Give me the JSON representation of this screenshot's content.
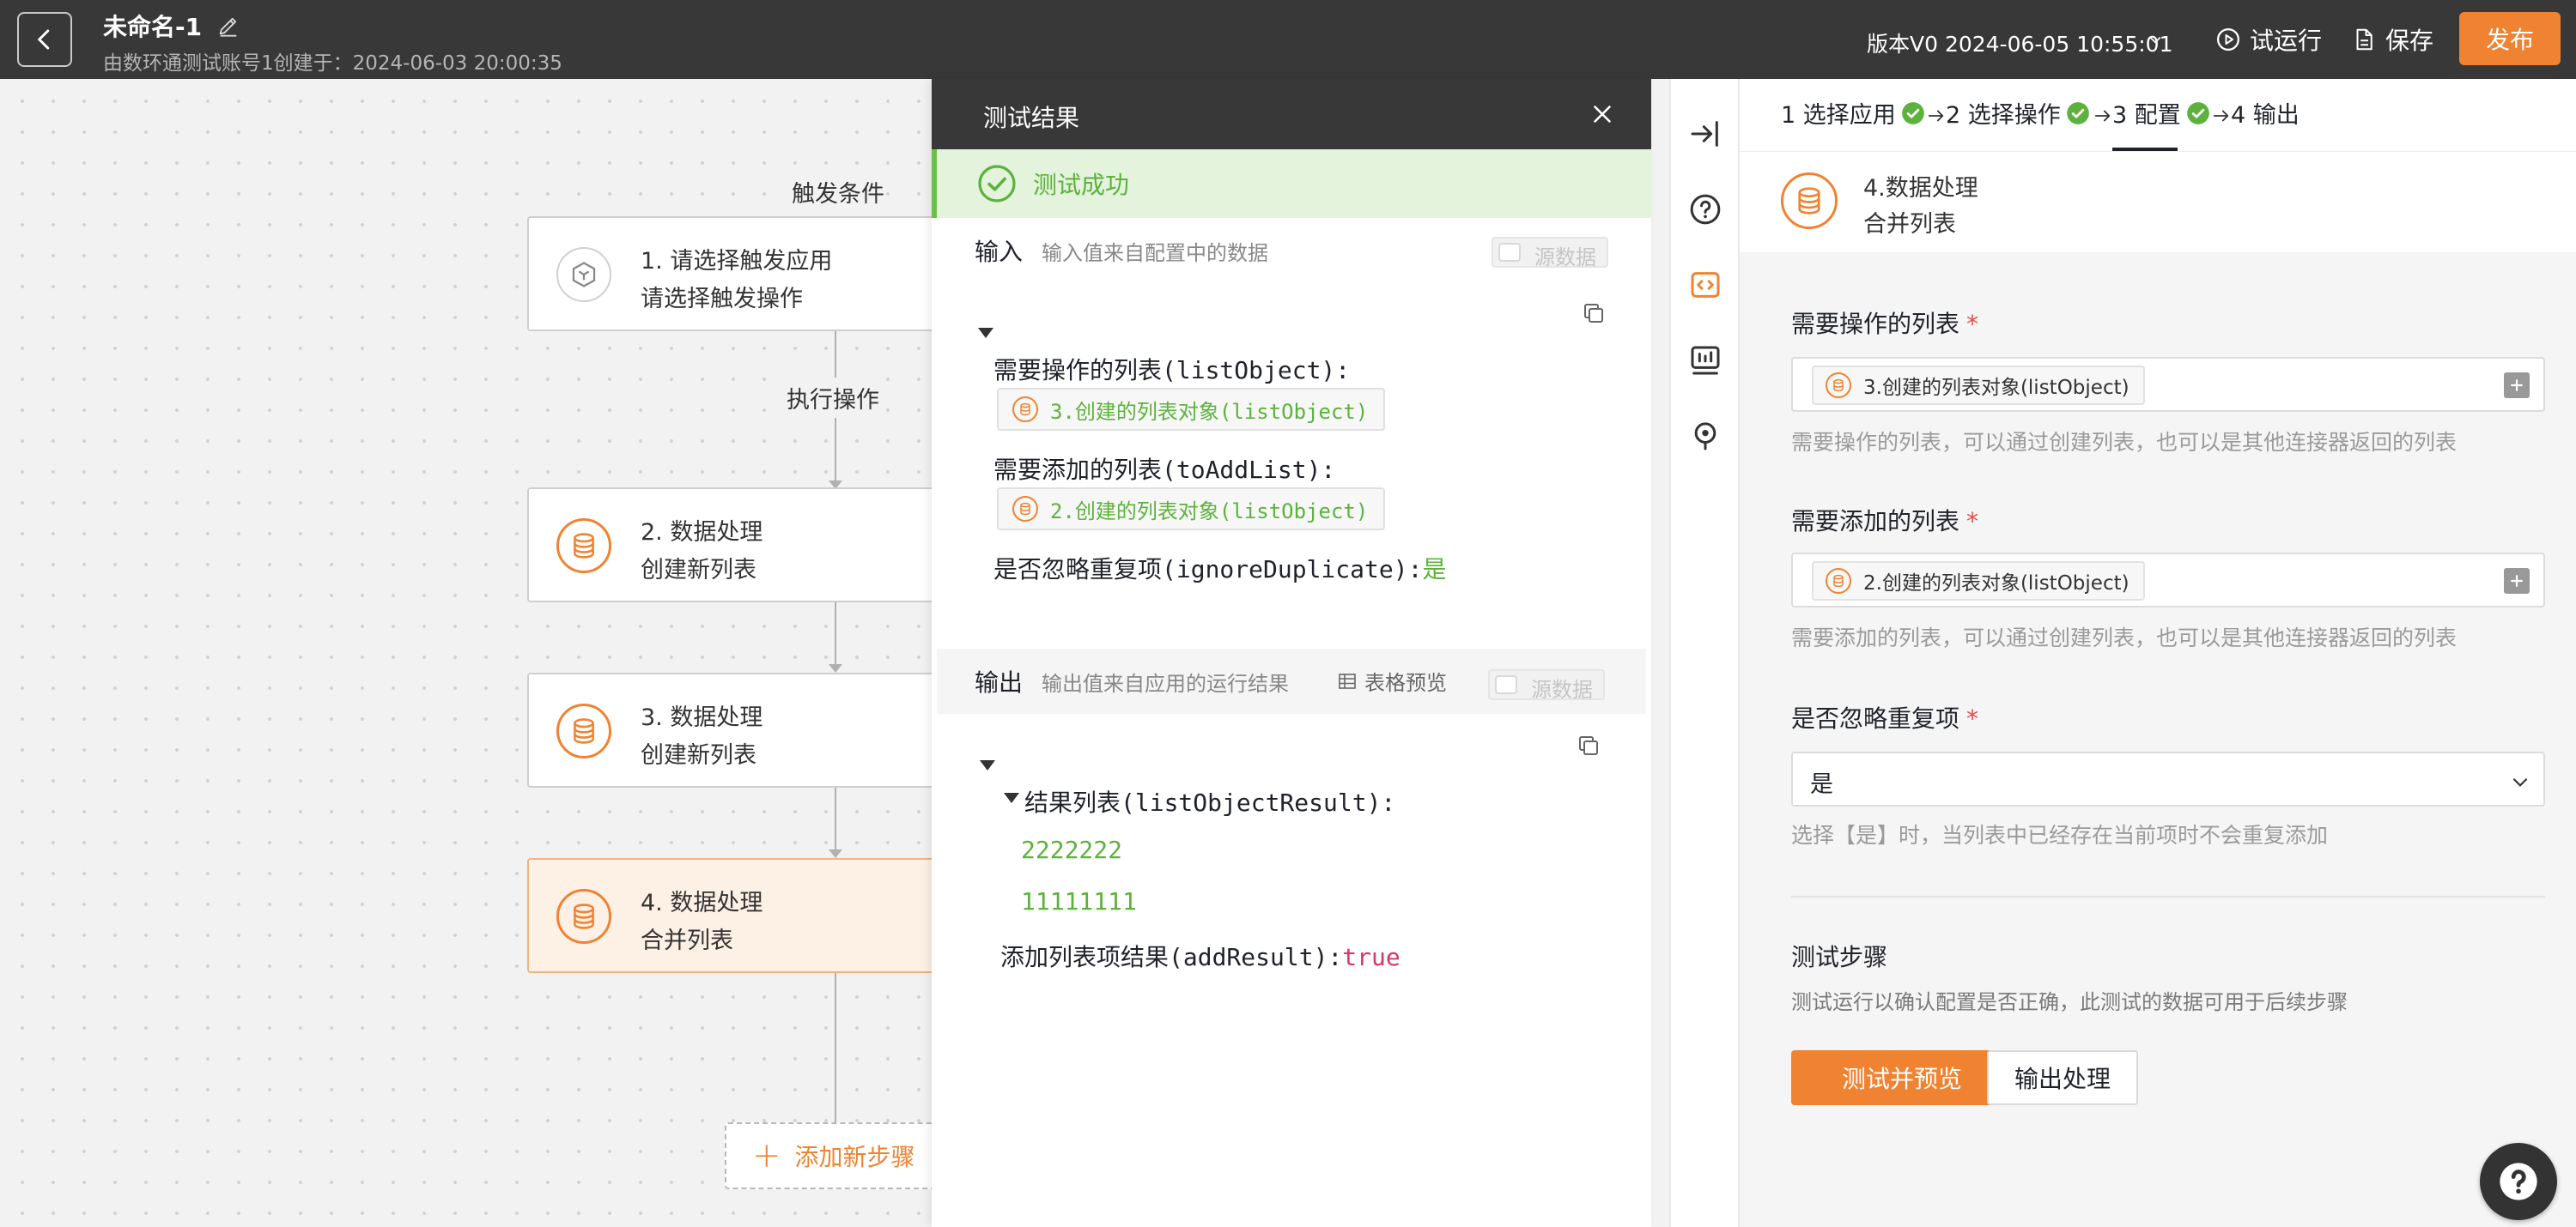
{
  "header": {
    "title": "未命名-1",
    "subtitle": "由数环通测试账号1创建于：2024-06-03 20:00:35",
    "version": "版本V0 2024-06-05 10:55:01",
    "trial_run": "试运行",
    "save": "保存",
    "publish": "发布",
    "accent_color": "#f08331"
  },
  "canvas": {
    "trigger_label": "触发条件",
    "action_label": "执行操作",
    "nodes": [
      {
        "line1": "1. 请选择触发应用",
        "line2": "请选择触发操作",
        "icon": "hexagon-app-icon"
      },
      {
        "line1": "2. 数据处理",
        "line2": "创建新列表",
        "icon": "database-icon"
      },
      {
        "line1": "3. 数据处理",
        "line2": "创建新列表",
        "icon": "database-icon"
      },
      {
        "line1": "4. 数据处理",
        "line2": "合并列表",
        "icon": "database-icon"
      }
    ],
    "add_step": "添加新步骤"
  },
  "test_panel": {
    "title": "测试结果",
    "status": "测试成功",
    "input": {
      "title": "输入",
      "desc": "输入值来自配置中的数据",
      "toggle_label": "源数据",
      "fields": [
        {
          "label": "需要操作的列表(listObject):",
          "tag": "3.创建的列表对象(listObject)"
        },
        {
          "label": "需要添加的列表(toAddList):",
          "tag": "2.创建的列表对象(listObject)"
        }
      ],
      "ignore_label": "是否忽略重复项(ignoreDuplicate):",
      "ignore_value": "是"
    },
    "output": {
      "title": "输出",
      "desc": "输出值来自应用的运行结果",
      "table_preview": "表格预览",
      "toggle_label": "源数据",
      "result_label": "结果列表(listObjectResult):",
      "result_values": [
        "2222222",
        "11111111"
      ],
      "add_label": "添加列表项结果(addResult):",
      "add_value": "true"
    }
  },
  "config": {
    "steps": [
      {
        "label": "1 选择应用",
        "done": true
      },
      {
        "label": "2 选择操作",
        "done": true
      },
      {
        "label": "3 配置",
        "done": true
      },
      {
        "label": "4 输出",
        "done": false
      }
    ],
    "node_title": "4.数据处理",
    "node_subtitle": "合并列表",
    "fields": [
      {
        "label": "需要操作的列表",
        "tag": "3.创建的列表对象(listObject)",
        "help": "需要操作的列表，可以通过创建列表，也可以是其他连接器返回的列表"
      },
      {
        "label": "需要添加的列表",
        "tag": "2.创建的列表对象(listObject)",
        "help": "需要添加的列表，可以通过创建列表，也可以是其他连接器返回的列表"
      }
    ],
    "ignore_label": "是否忽略重复项",
    "ignore_value": "是",
    "ignore_help": "选择【是】时，当列表中已经存在当前项时不会重复添加",
    "required_mark": "*",
    "test_title": "测试步骤",
    "test_desc": "测试运行以确认配置是否正确，此测试的数据可用于后续步骤",
    "test_btn": "测试并预览",
    "output_btn": "输出处理"
  }
}
